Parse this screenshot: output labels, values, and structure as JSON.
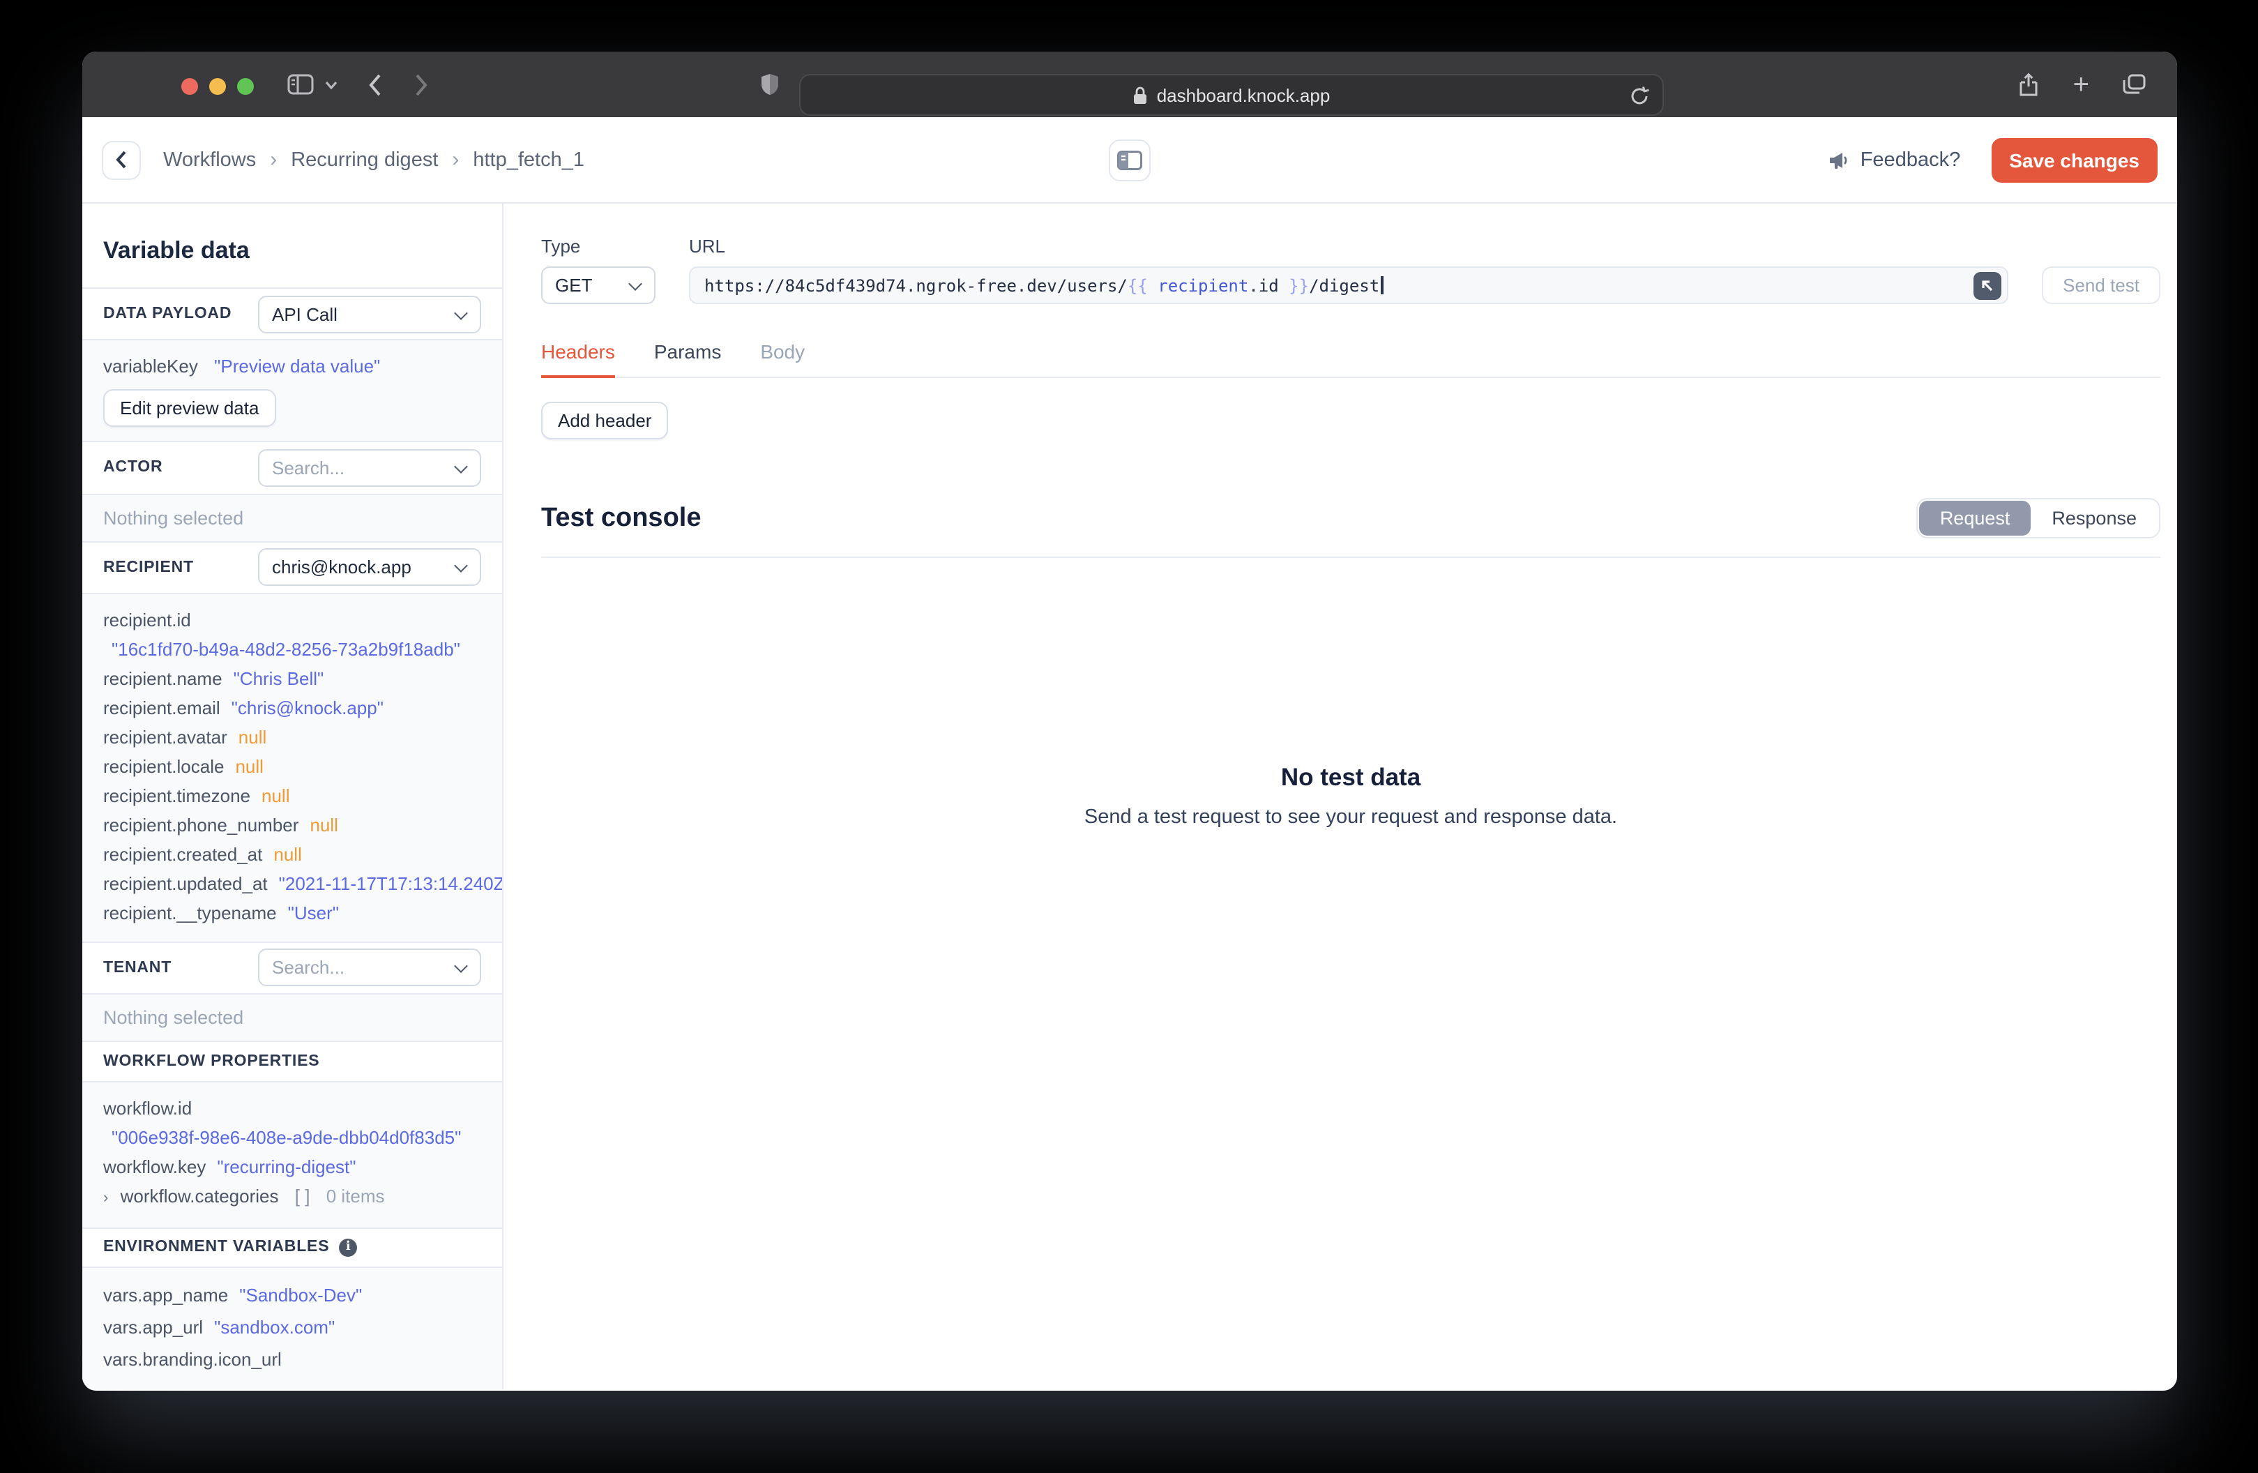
{
  "browser": {
    "address": "dashboard.knock.app",
    "icons": {
      "traffic": [
        "close",
        "minimize",
        "zoom"
      ],
      "plus_glyph": "+"
    }
  },
  "header": {
    "breadcrumb": {
      "items": [
        "Workflows",
        "Recurring digest",
        "http_fetch_1"
      ],
      "separator": "›"
    },
    "feedback": "Feedback?",
    "save": "Save changes"
  },
  "sidebar": {
    "title": "Variable data",
    "data_payload": {
      "label": "DATA PAYLOAD",
      "selected": "API Call"
    },
    "preview": {
      "row": {
        "key": "variableKey",
        "value": "\"Preview data value\""
      },
      "edit_button": "Edit preview data"
    },
    "actor": {
      "label": "ACTOR",
      "placeholder": "Search...",
      "empty": "Nothing selected"
    },
    "recipient": {
      "label": "RECIPIENT",
      "selected": "chris@knock.app",
      "rows": [
        {
          "key": "recipient.id",
          "value": "\"16c1fd70-b49a-48d2-8256-73a2b9f18adb\"",
          "type": "string"
        },
        {
          "key": "recipient.name",
          "value": "\"Chris Bell\"",
          "type": "string"
        },
        {
          "key": "recipient.email",
          "value": "\"chris@knock.app\"",
          "type": "string"
        },
        {
          "key": "recipient.avatar",
          "value": "null",
          "type": "null"
        },
        {
          "key": "recipient.locale",
          "value": "null",
          "type": "null"
        },
        {
          "key": "recipient.timezone",
          "value": "null",
          "type": "null"
        },
        {
          "key": "recipient.phone_number",
          "value": "null",
          "type": "null"
        },
        {
          "key": "recipient.created_at",
          "value": "null",
          "type": "null"
        },
        {
          "key": "recipient.updated_at",
          "value": "\"2021-11-17T17:13:14.240Z\"",
          "type": "string"
        },
        {
          "key": "recipient.__typename",
          "value": "\"User\"",
          "type": "string"
        }
      ]
    },
    "tenant": {
      "label": "TENANT",
      "placeholder": "Search...",
      "empty": "Nothing selected"
    },
    "workflow_properties": {
      "label": "WORKFLOW PROPERTIES",
      "rows": [
        {
          "key": "workflow.id",
          "value": "\"006e938f-98e6-408e-a9de-dbb04d0f83d5\""
        },
        {
          "key": "workflow.key",
          "value": "\"recurring-digest\""
        }
      ],
      "categories": {
        "twirl": "›",
        "key": "workflow.categories",
        "bracket": "[ ]",
        "count": "0 items"
      }
    },
    "environment_variables": {
      "label": "ENVIRONMENT VARIABLES",
      "rows": [
        {
          "key": "vars.app_name",
          "value": "\"Sandbox-Dev\""
        },
        {
          "key": "vars.app_url",
          "value": "\"sandbox.com\""
        },
        {
          "key": "vars.branding.icon_url",
          "value": ""
        }
      ]
    }
  },
  "request_editor": {
    "type_label": "Type",
    "method": "GET",
    "url_label": "URL",
    "url_segments": [
      {
        "text": "https://84c5df439d74.ngrok-free.dev/users/",
        "style": "plain"
      },
      {
        "text": "{{ ",
        "style": "brace"
      },
      {
        "text": "recipient",
        "style": "var"
      },
      {
        "text": ".id",
        "style": "plain"
      },
      {
        "text": " }}",
        "style": "brace"
      },
      {
        "text": "/digest",
        "style": "plain"
      }
    ],
    "send_test": "Send test",
    "tabs": [
      {
        "label": "Headers",
        "state": "active"
      },
      {
        "label": "Params",
        "state": "default"
      },
      {
        "label": "Body",
        "state": "muted"
      }
    ],
    "add_header": "Add header"
  },
  "test_console": {
    "title": "Test console",
    "toggle": {
      "options": [
        "Request",
        "Response"
      ],
      "selected": "Request"
    },
    "empty_title": "No test data",
    "empty_message": "Send a test request to see your request and response data."
  },
  "colors": {
    "accent": "#e4573d",
    "string_value": "#5c6ae0",
    "null_value": "#f09a33"
  }
}
